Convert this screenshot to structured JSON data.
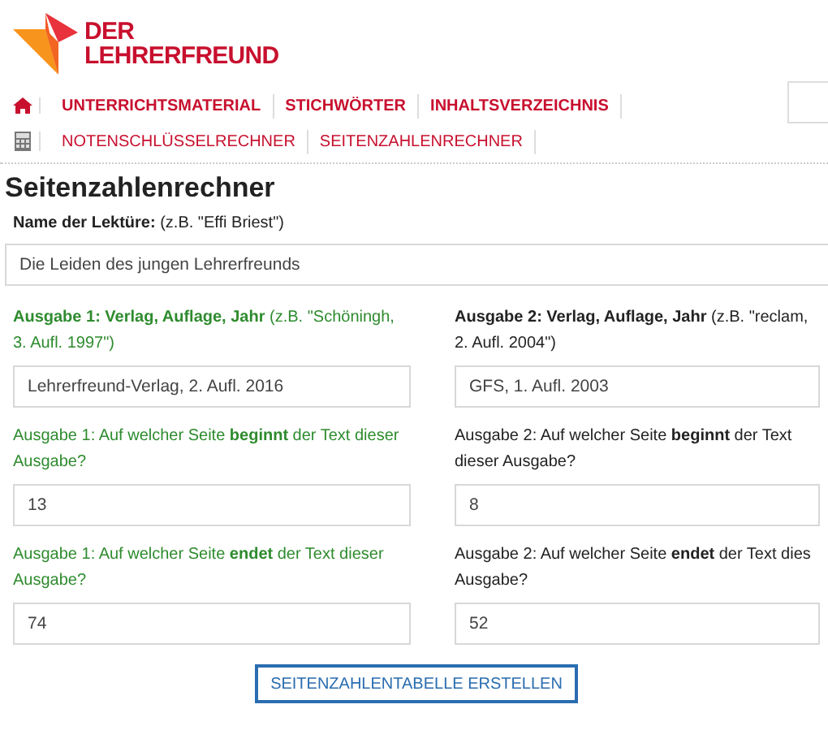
{
  "logo": {
    "line1": "DER",
    "line2": "LEHRERFREUND"
  },
  "nav_rows": [
    {
      "kind": "main",
      "items": [
        "UNTERRICHTSMATERIAL",
        "STICHWÖRTER",
        "INHALTSVERZEICHNIS"
      ]
    },
    {
      "kind": "tools",
      "items": [
        "NOTENSCHLÜSSELRECHNER",
        "SEITENZAHLENRECHNER"
      ]
    }
  ],
  "title": "Seitenzahlenrechner",
  "name_field": {
    "label": "**Name der Lektüre:** (z.B. \"Effi Briest\")",
    "value": "Die Leiden des jungen Lehrerfreunds"
  },
  "editions": [
    {
      "color": "#2e8b2e",
      "fields": [
        {
          "label": "**Ausgabe 1: Verlag, Auflage, Jahr** (z.B. \"Schöningh, 3. Aufl. 1997\")",
          "value": "Lehrerfreund-Verlag, 2. Aufl. 2016"
        },
        {
          "label": "Ausgabe 1: Auf welcher Seite **beginnt** der Text dieser Ausgabe?",
          "value": "13"
        },
        {
          "label": "Ausgabe 1: Auf welcher Seite **endet** der Text dieser Ausgabe?",
          "value": "74"
        }
      ]
    },
    {
      "color": "#222222",
      "fields": [
        {
          "label": "**Ausgabe 2: Verlag, Auflage, Jahr** (z.B. \"reclam, 2. Aufl. 2004\")",
          "value": "GFS, 1. Aufl. 2003"
        },
        {
          "label": "Ausgabe 2: Auf welcher Seite **beginnt** der Text dieser Ausgabe?",
          "value": "8"
        },
        {
          "label": "Ausgabe 2: Auf welcher Seite **endet** der Text dies Ausgabe?",
          "value": "52"
        }
      ]
    }
  ],
  "button": "SEITENZAHLENTABELLE ERSTELLEN"
}
